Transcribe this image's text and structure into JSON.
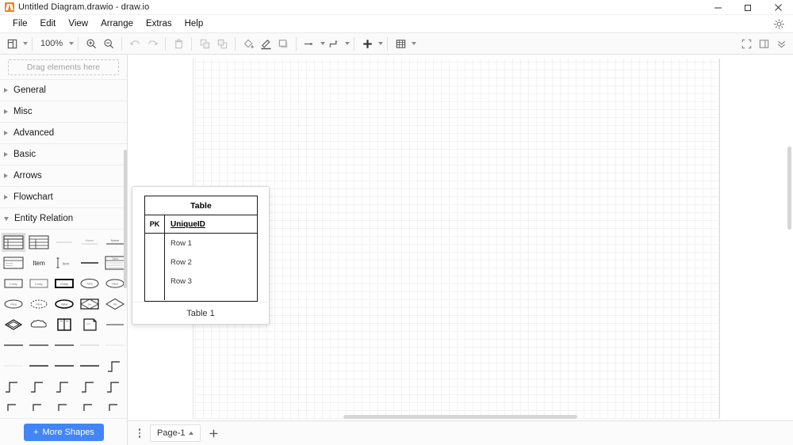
{
  "window": {
    "title": "Untitled Diagram.drawio - draw.io",
    "logo_icon": "drawio-logo-icon",
    "controls": [
      {
        "name": "minimize",
        "glyph": "—"
      },
      {
        "name": "maximize",
        "glyph": "❐"
      },
      {
        "name": "close",
        "glyph": "✕"
      }
    ]
  },
  "menubar": {
    "items": [
      {
        "label": "File"
      },
      {
        "label": "Edit"
      },
      {
        "label": "View"
      },
      {
        "label": "Arrange"
      },
      {
        "label": "Extras"
      },
      {
        "label": "Help"
      }
    ],
    "dark_mode_icon": "sun-brightness-icon"
  },
  "toolbar": {
    "view_icon": "view-layout-icon",
    "zoom_level": "100%",
    "zoom_in_icon": "zoom-in-icon",
    "zoom_out_icon": "zoom-out-icon",
    "undo_icon": "undo-icon",
    "redo_icon": "redo-icon",
    "delete_icon": "trash-icon",
    "to_front_icon": "bring-to-front-icon",
    "to_back_icon": "send-to-back-icon",
    "fill_color_icon": "fill-color-icon",
    "line_color_icon": "line-color-icon",
    "shadow_icon": "shadow-icon",
    "connection_icon": "connection-arrow-icon",
    "waypoints_icon": "waypoints-icon",
    "insert_icon": "insert-plus-icon",
    "table_icon": "table-grid-icon",
    "fullscreen_icon": "fullscreen-icon",
    "format_panel_icon": "format-panel-icon",
    "collapse_icon": "chevrons-down-icon"
  },
  "sidebar": {
    "dropzone_text": "Drag elements here",
    "sections": [
      {
        "label": "General",
        "expanded": false
      },
      {
        "label": "Misc",
        "expanded": false
      },
      {
        "label": "Advanced",
        "expanded": false
      },
      {
        "label": "Basic",
        "expanded": false
      },
      {
        "label": "Arrows",
        "expanded": false
      },
      {
        "label": "Flowchart",
        "expanded": false
      },
      {
        "label": "Entity Relation",
        "expanded": true
      }
    ],
    "entity_relation_shapes": [
      {
        "name": "table-with-rows-shape",
        "selected": true
      },
      {
        "name": "table-with-columns-shape",
        "selected": false
      },
      {
        "name": "thin-divider-shape",
        "selected": false
      },
      {
        "name": "dashed-label-line-shape",
        "selected": false
      },
      {
        "name": "label-over-line-shape",
        "selected": false
      },
      {
        "name": "table-list-shape",
        "selected": false
      },
      {
        "name": "item-text-shape",
        "selected": false,
        "label": "Item"
      },
      {
        "name": "left-bracket-item-shape",
        "selected": false
      },
      {
        "name": "solid-line-shape",
        "selected": false
      },
      {
        "name": "table-titled-rows-shape",
        "selected": false
      },
      {
        "name": "entity-rect-shape",
        "selected": false
      },
      {
        "name": "entity-rect-thin-shape",
        "selected": false
      },
      {
        "name": "entity-rect-bold-shape",
        "selected": false
      },
      {
        "name": "attribute-ellipse-shape",
        "selected": false
      },
      {
        "name": "attribute-ellipse-2-shape",
        "selected": false
      },
      {
        "name": "attribute-ellipse-3-shape",
        "selected": false
      },
      {
        "name": "derived-attribute-dashed-ellipse-shape",
        "selected": false
      },
      {
        "name": "key-attribute-ellipse-shape",
        "selected": false
      },
      {
        "name": "relationship-in-rect-shape",
        "selected": false
      },
      {
        "name": "relationship-diamond-shape",
        "selected": false
      },
      {
        "name": "diamond-outline-shape",
        "selected": false
      },
      {
        "name": "cloud-shape",
        "selected": false
      },
      {
        "name": "split-box-shape",
        "selected": false
      },
      {
        "name": "note-shape",
        "selected": false
      },
      {
        "name": "plain-line-shape",
        "selected": false
      }
    ],
    "more_shapes_label": "More Shapes",
    "more_shapes_icon": "plus-icon",
    "more_shapes_color": "#4285f4"
  },
  "canvas": {
    "preview": {
      "shape_label": "Table 1",
      "table": {
        "title": "Table",
        "pk_label": "PK",
        "pk_column": "UniqueID",
        "rows": [
          "Row 1",
          "Row 2",
          "Row 3"
        ]
      }
    }
  },
  "bottombar": {
    "pages_menu_icon": "vertical-dots-icon",
    "page_tab_label": "Page-1",
    "page_tab_chevron_icon": "chevron-up-icon",
    "add_page_icon": "plus-icon"
  }
}
